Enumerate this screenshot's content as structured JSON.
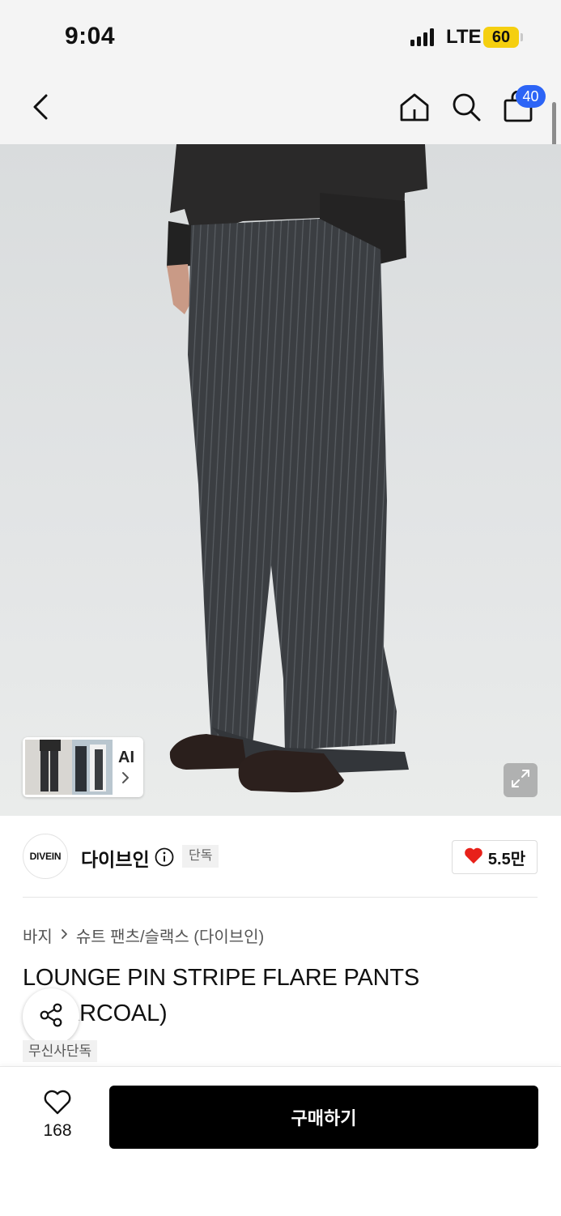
{
  "status_bar": {
    "time": "9:04",
    "network": "LTE",
    "battery": "60",
    "battery_color": "#f5cf10"
  },
  "header": {
    "icons": [
      "back-chevron-icon",
      "home-icon",
      "search-icon",
      "shopping-bag-icon"
    ],
    "cart_count": "40",
    "badge_color": "#2c64f6"
  },
  "gallery": {
    "ai_label": "AI",
    "thumbnail_icons": [
      "ai-thumbnail-image",
      "chevron-right-icon"
    ],
    "expand_icon": "expand-icon"
  },
  "brand": {
    "logo_text": "DIVEIN",
    "name": "다이브인",
    "exclusive_tag": "단독",
    "like_count": "5.5만",
    "heart_color": "#e8211a"
  },
  "product": {
    "breadcrumb": [
      "바지",
      "슈트 팬츠/슬랙스 (다이브인)"
    ],
    "title": "LOUNGE PIN STRIPE FLARE PANTS (CHARCOAL)",
    "tag": "무신사단독"
  },
  "bottom_bar": {
    "like_count": "168",
    "buy_label": "구매하기",
    "buy_button_color": "#000000"
  }
}
